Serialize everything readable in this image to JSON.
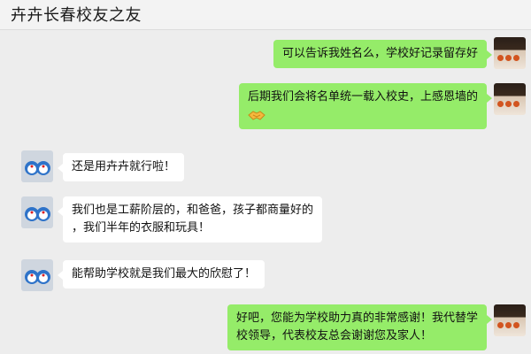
{
  "header": {
    "title": "卉卉长春校友之友"
  },
  "messages": [
    {
      "side": "self",
      "lines": [
        "可以告诉我姓名么，学校好记录留存好"
      ]
    },
    {
      "side": "self",
      "lines": [
        "后期我们会将名单统一载入校史，上感恩墙的"
      ],
      "emoji": "handshake-icon"
    },
    {
      "side": "peer",
      "lines": [
        "还是用卉卉就行啦！"
      ]
    },
    {
      "side": "peer",
      "lines": [
        "我们也是工薪阶层的，和爸爸，孩子都商量好的",
        "，我们半年的衣服和玩具！"
      ]
    },
    {
      "side": "peer",
      "lines": [
        "能帮助学校就是我们最大的欣慰了！"
      ]
    },
    {
      "side": "self",
      "lines": [
        "好吧，您能为学校助力真的非常感谢！我代替学",
        "校领导，代表校友总会谢谢您及家人！"
      ]
    }
  ],
  "colors": {
    "self_bubble": "#95ec69",
    "peer_bubble": "#ffffff",
    "background": "#ededed"
  }
}
